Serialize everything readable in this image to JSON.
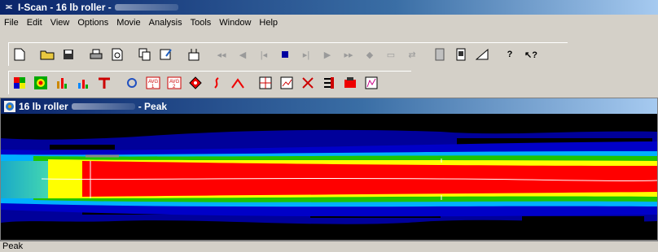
{
  "window": {
    "title": "I-Scan - 16 lb roller -"
  },
  "menu": [
    "File",
    "Edit",
    "View",
    "Options",
    "Movie",
    "Analysis",
    "Tools",
    "Window",
    "Help"
  ],
  "document": {
    "title_prefix": "16 lb roller",
    "title_suffix": "- Peak"
  },
  "statusbar": {
    "text": "Peak"
  },
  "colors": {
    "background": "#00009a",
    "red": "#ff0000",
    "green": "#1fc400",
    "yellow": "#ffff00",
    "cyan": "#00c8d8",
    "black": "#000000"
  }
}
